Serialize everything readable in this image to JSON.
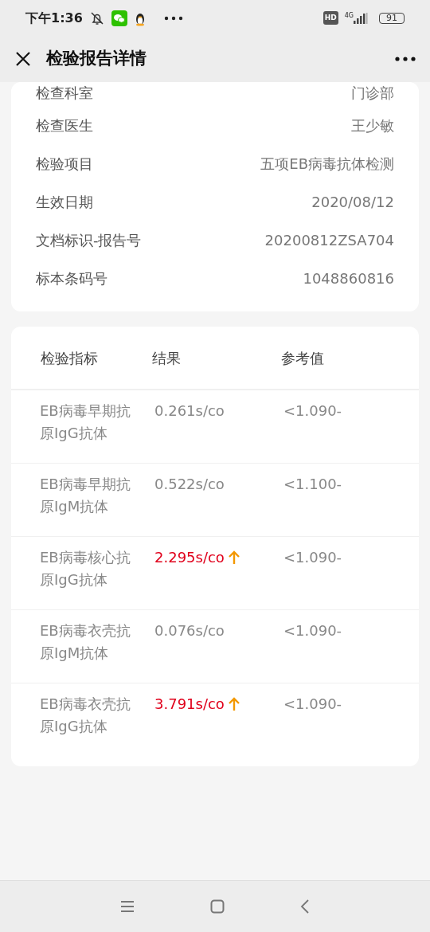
{
  "status_bar": {
    "time": "下午1:36",
    "hd": "HD",
    "network": "4G",
    "battery": "91"
  },
  "header": {
    "title": "检验报告详情"
  },
  "info": [
    {
      "label": "检查科室",
      "value": "门诊部"
    },
    {
      "label": "检查医生",
      "value": "王少敏"
    },
    {
      "label": "检验项目",
      "value": "五项EB病毒抗体检测"
    },
    {
      "label": "生效日期",
      "value": "2020/08/12"
    },
    {
      "label": "文档标识-报告号",
      "value": "20200812ZSA704"
    },
    {
      "label": "标本条码号",
      "value": "1048860816"
    }
  ],
  "table": {
    "columns": [
      "检验指标",
      "结果",
      "参考值"
    ],
    "rows": [
      {
        "name": "EB病毒早期抗原IgG抗体",
        "result": "0.261s/co",
        "reference": "<1.090-",
        "high": false
      },
      {
        "name": "EB病毒早期抗原IgM抗体",
        "result": "0.522s/co",
        "reference": "<1.100-",
        "high": false
      },
      {
        "name": "EB病毒核心抗原IgG抗体",
        "result": "2.295s/co",
        "reference": "<1.090-",
        "high": true
      },
      {
        "name": "EB病毒衣壳抗原IgM抗体",
        "result": "0.076s/co",
        "reference": "<1.090-",
        "high": false
      },
      {
        "name": "EB病毒衣壳抗原IgG抗体",
        "result": "3.791s/co",
        "reference": "<1.090-",
        "high": true
      }
    ]
  }
}
